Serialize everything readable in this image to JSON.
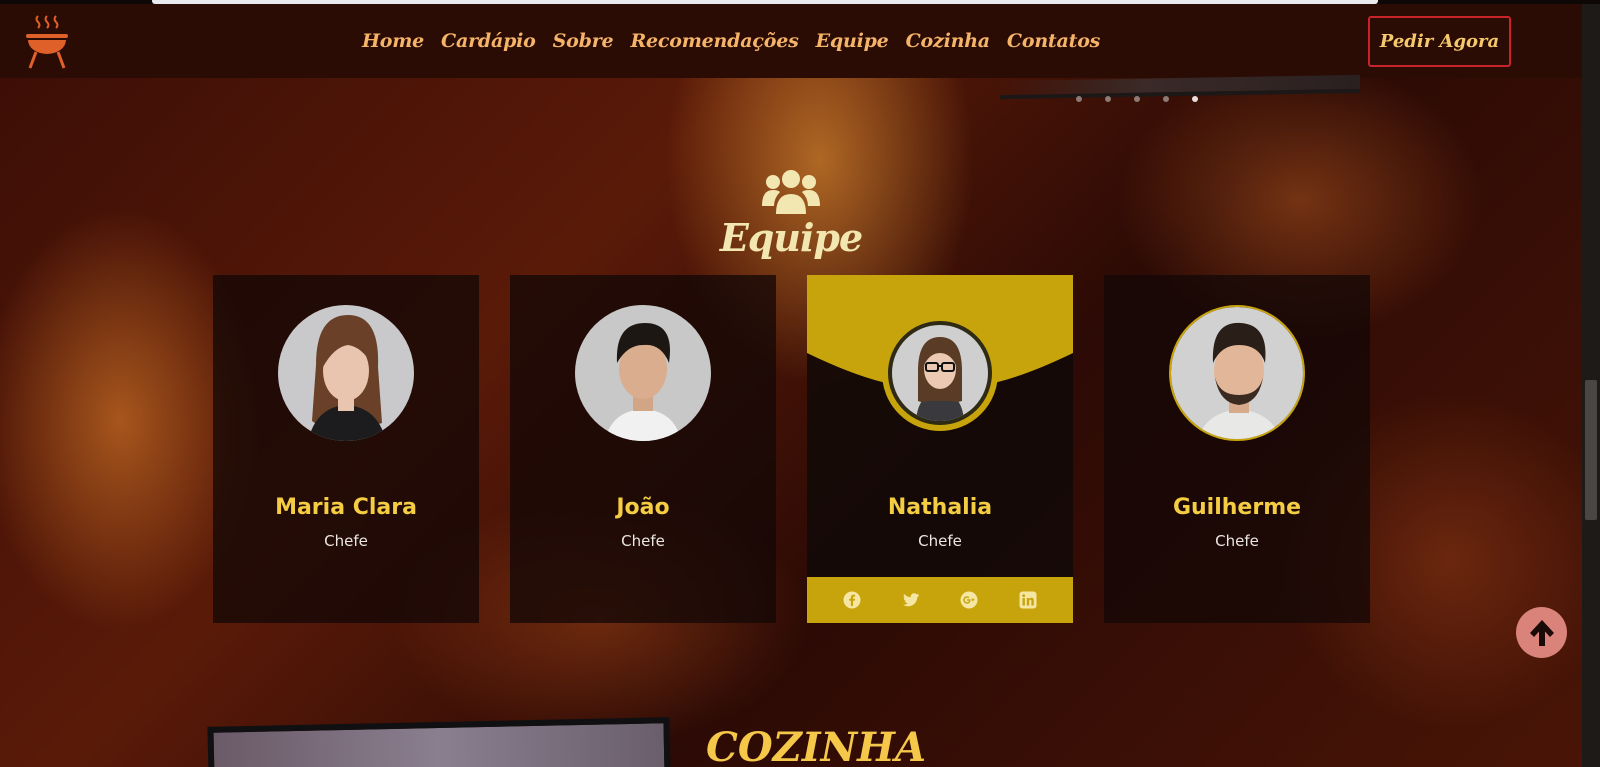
{
  "nav": {
    "logo": "grill-logo",
    "links": [
      "Home",
      "Cardápio",
      "Sobre",
      "Recomendações",
      "Equipe",
      "Cozinha",
      "Contatos"
    ],
    "cta_label": "Pedir Agora"
  },
  "slider": {
    "dot_count": 5,
    "active_index": 4
  },
  "team": {
    "icon": "users-icon",
    "title": "Equipe",
    "members": [
      {
        "name": "Maria Clara",
        "role": "Chefe"
      },
      {
        "name": "João",
        "role": "Chefe"
      },
      {
        "name": "Nathalia",
        "role": "Chefe"
      },
      {
        "name": "Guilherme",
        "role": "Chefe"
      }
    ],
    "social_icons": [
      "facebook-icon",
      "twitter-icon",
      "google-plus-icon",
      "linkedin-icon"
    ]
  },
  "next_section": {
    "title": "COZINHA"
  },
  "colors": {
    "nav_bg": "#2a0c05",
    "nav_link": "#f6b469",
    "cta_border": "#c7232b",
    "accent_gold": "#c8a40c",
    "name_yellow": "#f5cd42",
    "to_top_bg": "#d9837a"
  }
}
